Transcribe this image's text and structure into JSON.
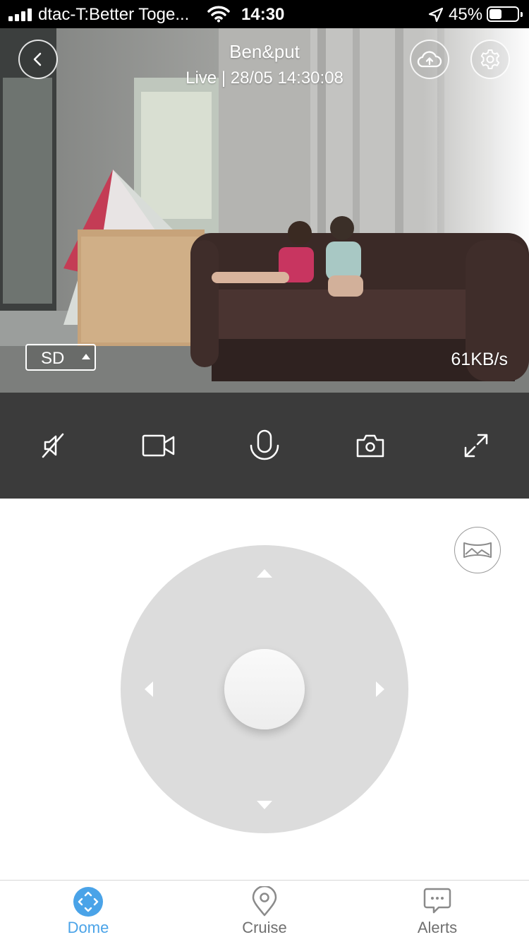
{
  "status_bar": {
    "carrier": "dtac-T:Better Toge...",
    "time": "14:30",
    "battery_percent": "45%",
    "battery_level": 0.45,
    "signal_icon": "signal-bars-icon",
    "wifi_icon": "wifi-icon",
    "location_icon": "location-arrow-icon"
  },
  "video": {
    "camera_name": "Ben&put",
    "live_status": "Live | 28/05 14:30:08",
    "quality": "SD",
    "bitrate": "61KB/s",
    "back_icon": "chevron-left-icon",
    "cloud_icon": "cloud-upload-icon",
    "settings_icon": "gear-icon"
  },
  "controls": [
    {
      "name": "mute-toggle",
      "icon": "speaker-muted-icon"
    },
    {
      "name": "record",
      "icon": "video-camera-icon"
    },
    {
      "name": "talk",
      "icon": "microphone-icon"
    },
    {
      "name": "snapshot",
      "icon": "camera-icon"
    },
    {
      "name": "fullscreen",
      "icon": "expand-icon"
    }
  ],
  "ptz": {
    "panorama_icon": "panorama-icon"
  },
  "tabs": [
    {
      "label": "Dome",
      "icon": "dome-icon",
      "active": true
    },
    {
      "label": "Cruise",
      "icon": "map-pin-icon",
      "active": false
    },
    {
      "label": "Alerts",
      "icon": "message-icon",
      "active": false
    }
  ],
  "colors": {
    "accent": "#4aa3e8",
    "control_bar": "#3b3b3b",
    "pad": "#dcdcdc"
  }
}
